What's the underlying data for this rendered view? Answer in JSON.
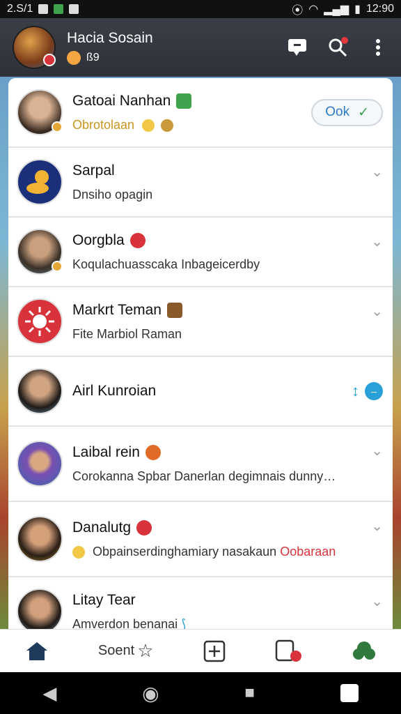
{
  "status_bar": {
    "left_text": "2.S/1",
    "time": "12:90"
  },
  "header": {
    "title": "Hacia Sosain",
    "sub_text": "ß9"
  },
  "chats": [
    {
      "name": "Gatoai Nanhan",
      "message": "Obrotolaan",
      "message_style": "gold",
      "action": "pill",
      "action_label": "Ook",
      "avatar_color": "#6b4a3a",
      "name_emoji_color": "#3fa34d"
    },
    {
      "name": "Sarpal",
      "message": "Dnsiho opagin",
      "action": "chevron",
      "avatar_color": "#1b2f7a"
    },
    {
      "name": "Oorgbla",
      "message": "Koqulachuasscaka Inbageicerdby",
      "action": "chevron",
      "avatar_color": "#5a4a3c",
      "name_emoji_color": "#d8323b"
    },
    {
      "name": "Markrt Teman",
      "message": "Fite Marbiol Raman",
      "message_prefix_color": "#8dbb2a",
      "action": "chevron",
      "avatar_color": "#d8323b",
      "name_emoji_color": "#8a5a2a"
    },
    {
      "name": "Airl Kunroian",
      "message": "",
      "action": "indicator",
      "avatar_color": "#2d2a28"
    },
    {
      "name": "Laibal rein",
      "message": "Corokanna Spbar Danerlan degimnais dunny…",
      "action": "chevron",
      "avatar_color": "#3b67b0",
      "name_emoji_color": "#e06a28"
    },
    {
      "name": "Danalutg",
      "message": "Obpainserdinghamiary nasakaun",
      "message_suffix": "Oobaraan",
      "action": "chevron",
      "avatar_color": "#3a2a1e",
      "name_emoji_color": "#d8323b"
    },
    {
      "name": "Litay Tear",
      "message": "Amverdon benanai",
      "action": "chevron",
      "avatar_color": "#2b2622"
    }
  ],
  "bottom_nav": {
    "center_text": "Soent"
  },
  "colors": {
    "accent": "#2d79c7",
    "header": "#32363d"
  }
}
